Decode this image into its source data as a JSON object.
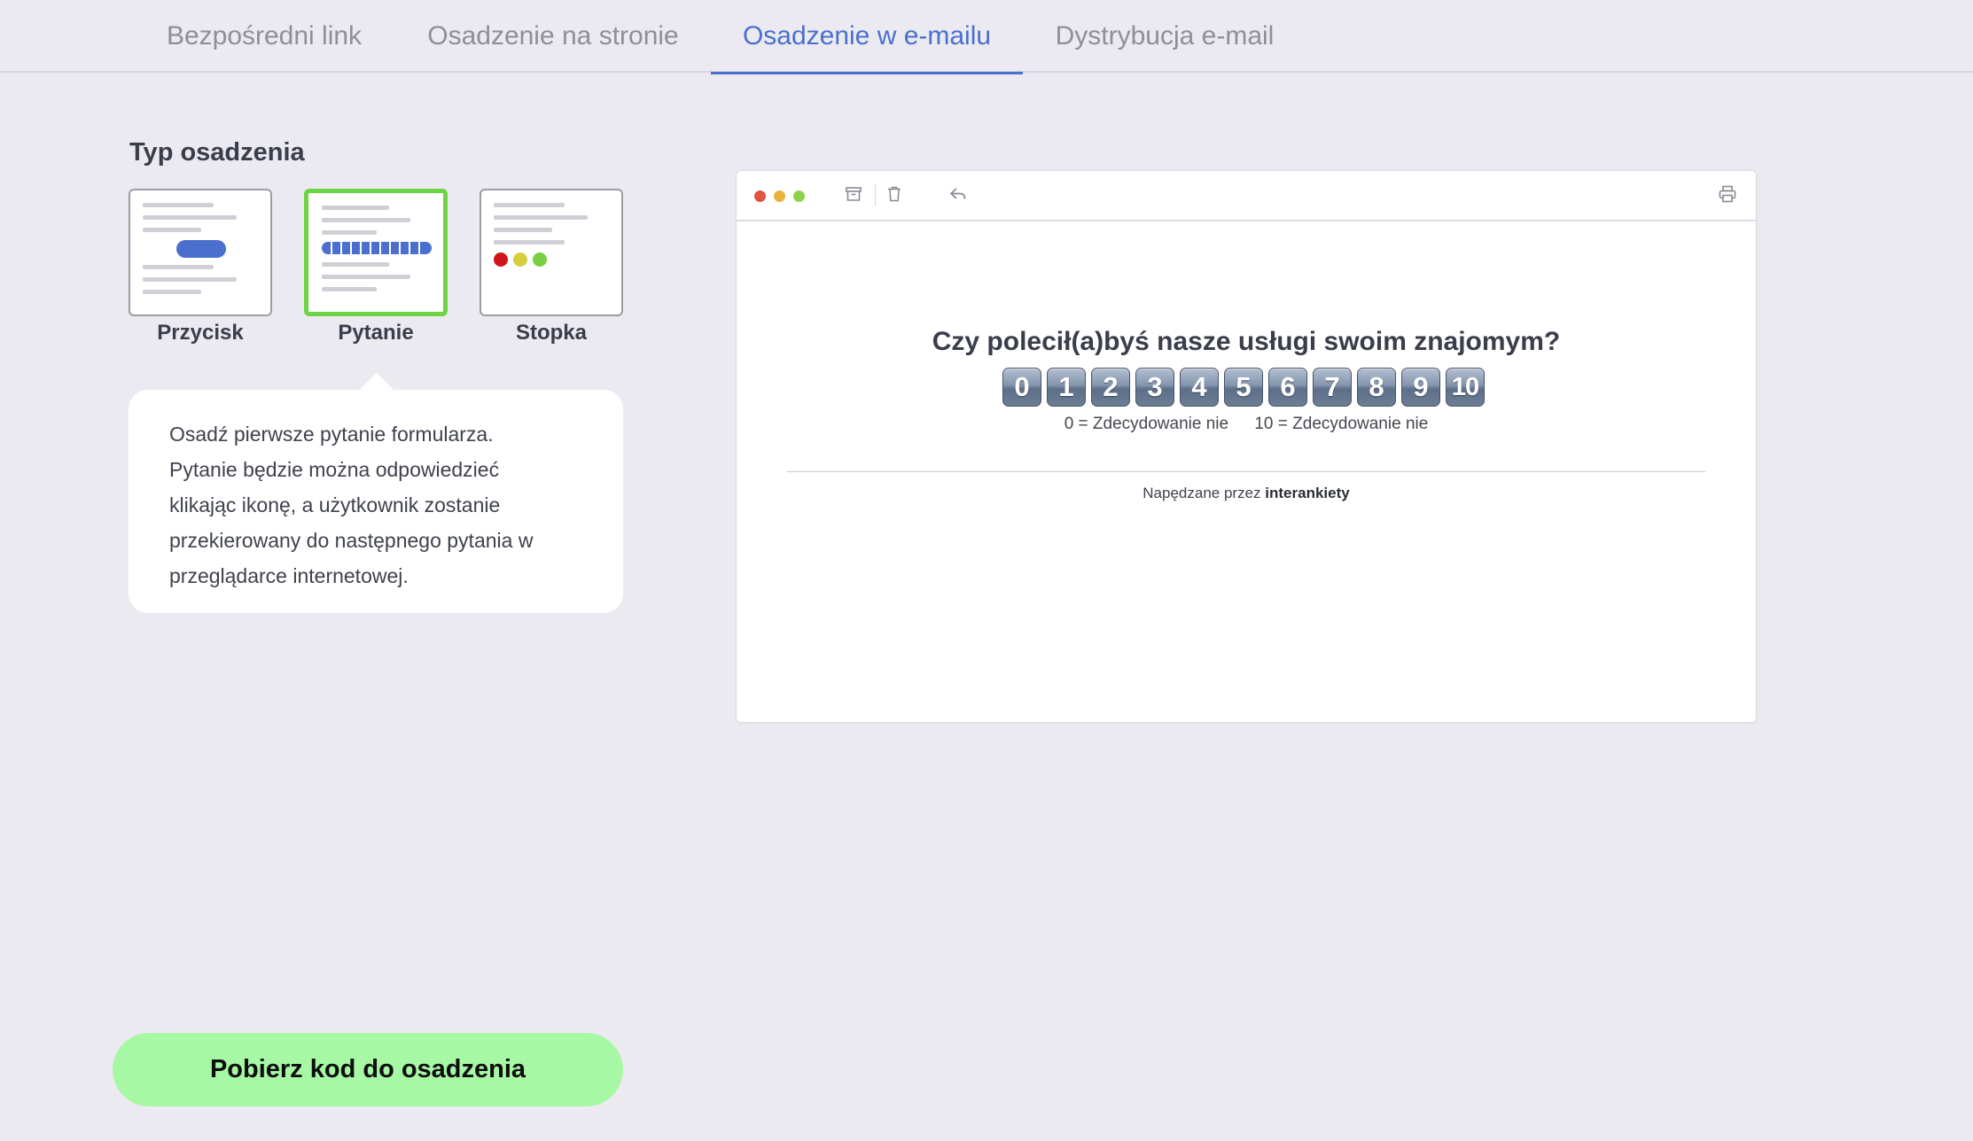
{
  "tabs": [
    {
      "label": "Bezpośredni link",
      "active": false
    },
    {
      "label": "Osadzenie na stronie",
      "active": false
    },
    {
      "label": "Osadzenie w e-mailu",
      "active": true
    },
    {
      "label": "Dystrybucja e-mail",
      "active": false
    }
  ],
  "embed_type": {
    "title": "Typ osadzenia",
    "options": [
      {
        "label": "Przycisk",
        "selected": false
      },
      {
        "label": "Pytanie",
        "selected": true
      },
      {
        "label": "Stopka",
        "selected": false
      }
    ],
    "description": [
      "Osadź pierwsze pytanie formularza.",
      "Pytanie będzie można odpowiedzieć",
      "klikając ikonę, a użytkownik zostanie",
      "przekierowany do następnego pytania w",
      "przeglądarce internetowej."
    ]
  },
  "preview": {
    "question": "Czy polecił(a)byś nasze usługi swoim znajomym?",
    "scale": [
      "0",
      "1",
      "2",
      "3",
      "4",
      "5",
      "6",
      "7",
      "8",
      "9",
      "10"
    ],
    "low_label": "0 = Zdecydowanie nie",
    "high_label": "10 = Zdecydowanie nie",
    "powered_prefix": "Napędzane przez",
    "powered_brand": "interankiety"
  },
  "cta": {
    "label": "Pobierz kod do osadzenia"
  },
  "colors": {
    "accent": "#4b6fcf",
    "selected_border": "#6dd444",
    "cta_bg": "#a6f8a4",
    "dot_red": "#e0553f",
    "dot_yellow": "#e7b33b",
    "dot_green": "#8fd14a"
  }
}
